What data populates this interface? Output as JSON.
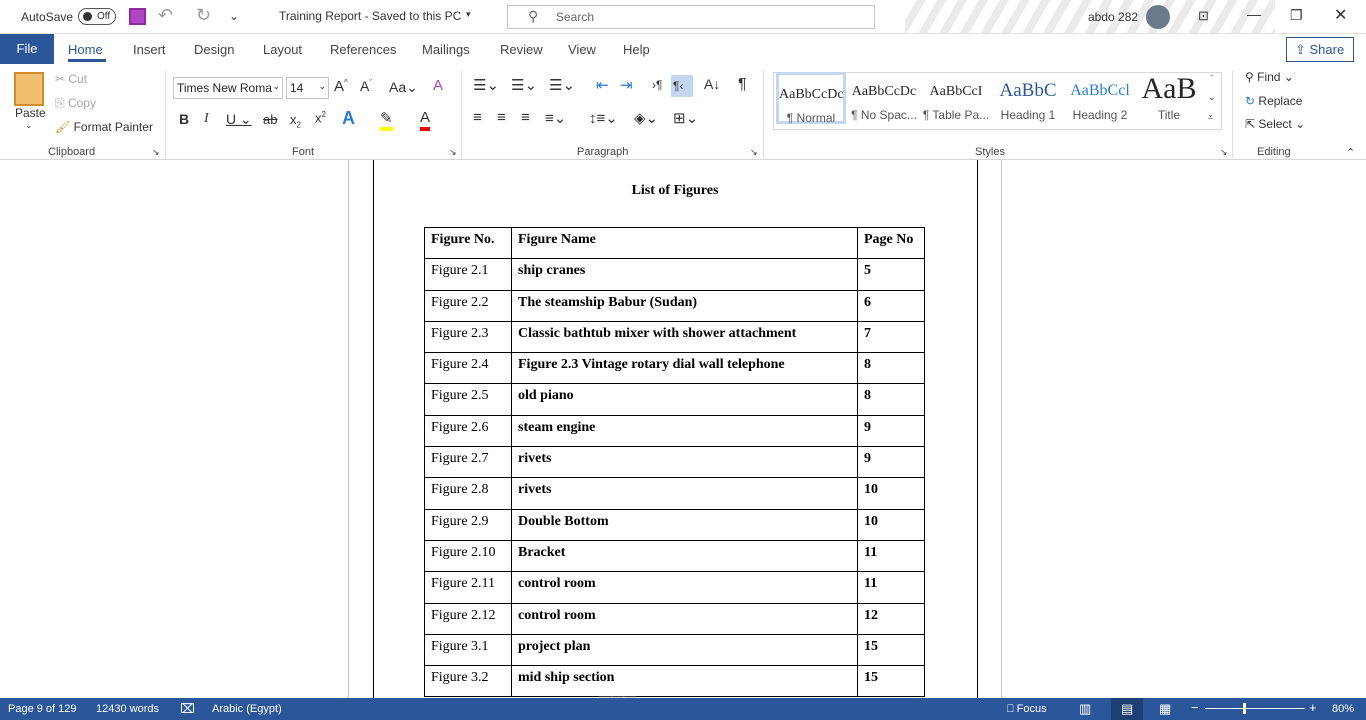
{
  "titlebar": {
    "autosave": "AutoSave",
    "autosave_state": "Off",
    "doc_title": "Training Report  -  Saved to this PC",
    "search_placeholder": "Search",
    "user": "abdo 282"
  },
  "tabs": [
    "File",
    "Home",
    "Insert",
    "Design",
    "Layout",
    "References",
    "Mailings",
    "Review",
    "View",
    "Help"
  ],
  "share": "Share",
  "clipboard": {
    "paste": "Paste",
    "cut": "Cut",
    "copy": "Copy",
    "format_painter": "Format Painter",
    "label": "Clipboard"
  },
  "font": {
    "name": "Times New Roma",
    "size": "14",
    "label": "Font",
    "highlight_color": "#ffff00",
    "font_color": "#ff0000"
  },
  "paragraph": {
    "label": "Paragraph"
  },
  "styles": {
    "label": "Styles",
    "items": [
      {
        "sample": "AaBbCcDc",
        "name": "¶ Normal"
      },
      {
        "sample": "AaBbCcDc",
        "name": "¶ No Spac..."
      },
      {
        "sample": "AaBbCcI",
        "name": "¶ Table Pa..."
      },
      {
        "sample": "AaBbC",
        "name": "Heading 1"
      },
      {
        "sample": "AaBbCcl",
        "name": "Heading 2"
      },
      {
        "sample": "AaB",
        "name": "Title"
      }
    ]
  },
  "editing": {
    "find": "Find",
    "replace": "Replace",
    "select": "Select",
    "label": "Editing"
  },
  "document": {
    "title": "List of Figures",
    "headers": [
      "Figure No.",
      "Figure Name",
      "Page No"
    ],
    "rows": [
      [
        "Figure 2.1",
        "ship cranes",
        "5"
      ],
      [
        "Figure 2.2",
        "The steamship Babur (Sudan)",
        "6"
      ],
      [
        "Figure 2.3",
        "Classic bathtub mixer with shower attachment",
        "7"
      ],
      [
        "Figure 2.4",
        "Figure 2.3 Vintage rotary dial wall telephone",
        "8"
      ],
      [
        "Figure 2.5",
        "old piano",
        "8"
      ],
      [
        "Figure 2.6",
        "steam engine",
        "9"
      ],
      [
        "Figure 2.7",
        "rivets",
        "9"
      ],
      [
        "Figure 2.8",
        "rivets",
        "10"
      ],
      [
        "Figure 2.9",
        "Double Bottom",
        "10"
      ],
      [
        "Figure 2.10",
        "Bracket",
        "11"
      ],
      [
        "Figure 2.11",
        "control room",
        "11"
      ],
      [
        "Figure 2.12",
        "control room",
        "12"
      ],
      [
        "Figure 3.1",
        "project plan",
        "15"
      ],
      [
        "Figure 3.2",
        "mid ship section",
        "15"
      ]
    ]
  },
  "status": {
    "page": "Page 9 of 129",
    "words": "12430 words",
    "language": "Arabic (Egypt)",
    "focus": "Focus",
    "zoom": "80%",
    "zoom_percent": 80
  },
  "colors": {
    "accent": "#2b579a"
  }
}
